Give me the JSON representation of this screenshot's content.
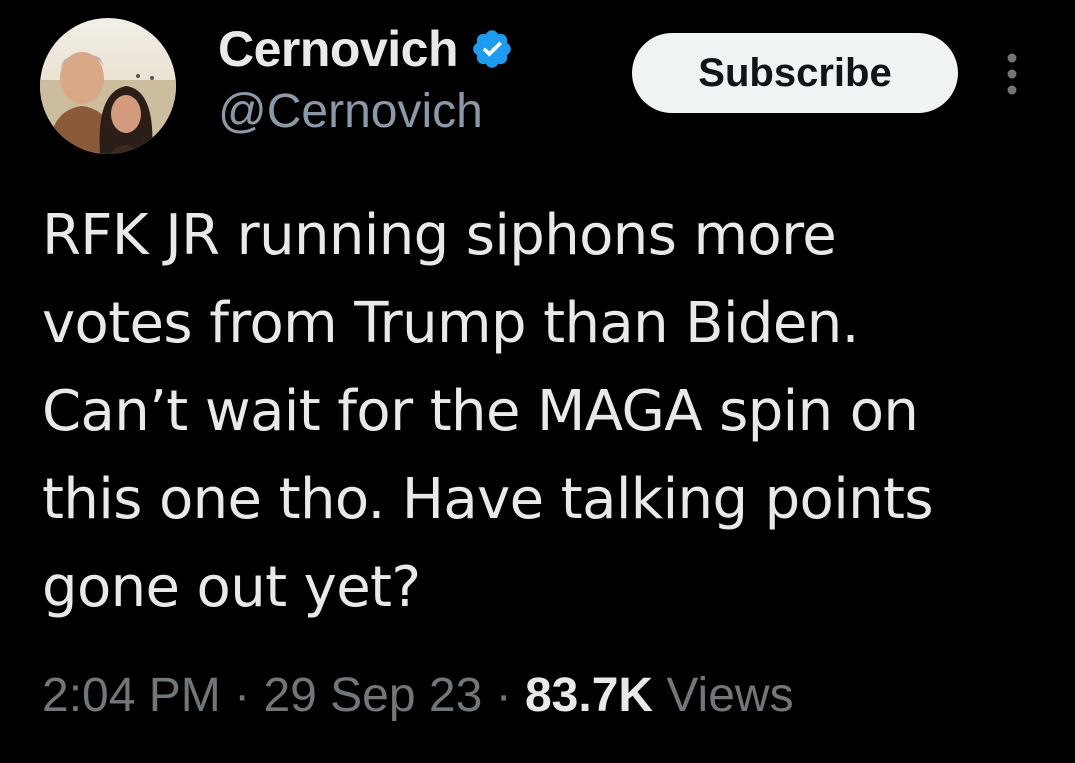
{
  "author": {
    "display_name": "Cernovich",
    "handle": "@Cernovich",
    "verified": true,
    "verified_color": "#1d9bf0"
  },
  "actions": {
    "subscribe_label": "Subscribe",
    "more_icon": "more-vertical-icon"
  },
  "tweet": {
    "lines": [
      "RFK JR running siphons more",
      "votes from Trump than Biden.",
      "Can’t wait for the MAGA spin on",
      "this one tho. Have talking points",
      "gone out yet?"
    ]
  },
  "meta": {
    "time": "2:04 PM",
    "separator": "·",
    "date": "29 Sep 23",
    "views_count": "83.7K",
    "views_label": "Views"
  },
  "colors": {
    "background": "#000000",
    "text_primary": "#e7e9ea",
    "text_secondary": "#71767b",
    "button_bg": "#eff3f4"
  }
}
